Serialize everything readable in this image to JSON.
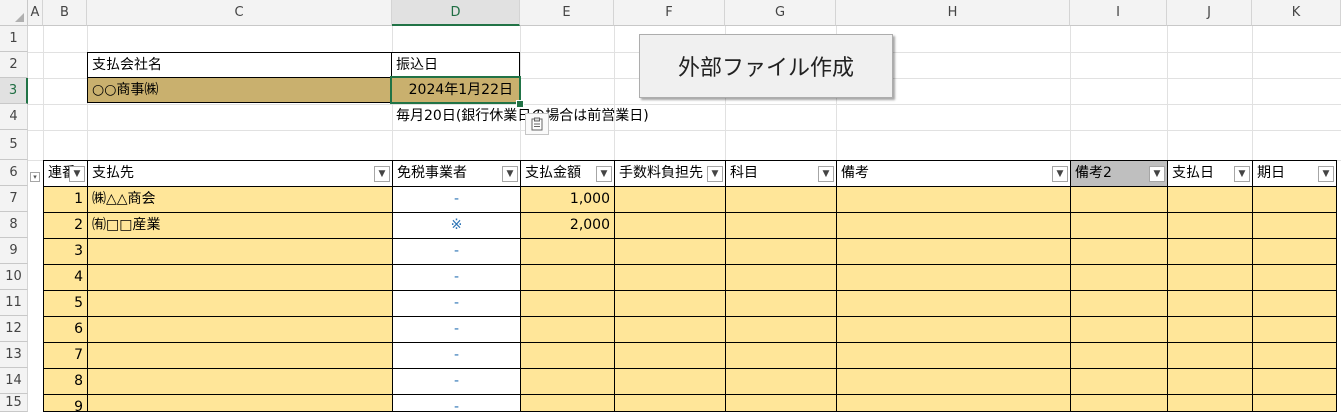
{
  "columns": [
    "A",
    "B",
    "C",
    "D",
    "E",
    "F",
    "G",
    "H",
    "I",
    "J",
    "K"
  ],
  "rows": [
    "1",
    "2",
    "3",
    "4",
    "5",
    "6",
    "7",
    "8",
    "9",
    "10",
    "11",
    "12",
    "13",
    "14",
    "15"
  ],
  "header_block": {
    "company_label": "支払会社名",
    "date_label": "振込日",
    "company_value": "○○商事㈱",
    "date_value": "2024年1月22日",
    "note": "毎月20日(銀行休業日の場合は前営業日)"
  },
  "button_label": "外部ファイル作成",
  "table": {
    "headers": [
      "連番",
      "支払先",
      "免税事業者",
      "支払金額",
      "手数料負担先",
      "科目",
      "備考",
      "備考2",
      "支払日",
      "期日"
    ],
    "rows": [
      {
        "no": "1",
        "payee": "㈱△△商会",
        "exempt": "-",
        "amount": "1,000"
      },
      {
        "no": "2",
        "payee": "㈲□□産業",
        "exempt": "※",
        "amount": "2,000"
      },
      {
        "no": "3",
        "payee": "",
        "exempt": "-",
        "amount": ""
      },
      {
        "no": "4",
        "payee": "",
        "exempt": "-",
        "amount": ""
      },
      {
        "no": "5",
        "payee": "",
        "exempt": "-",
        "amount": ""
      },
      {
        "no": "6",
        "payee": "",
        "exempt": "-",
        "amount": ""
      },
      {
        "no": "7",
        "payee": "",
        "exempt": "-",
        "amount": ""
      },
      {
        "no": "8",
        "payee": "",
        "exempt": "-",
        "amount": ""
      },
      {
        "no": "9",
        "payee": "",
        "exempt": "-",
        "amount": ""
      }
    ]
  },
  "colors": {
    "yellow": "#ffe699",
    "tan": "#c9b06e",
    "selection": "#217346",
    "accent": "#2e75b6"
  }
}
